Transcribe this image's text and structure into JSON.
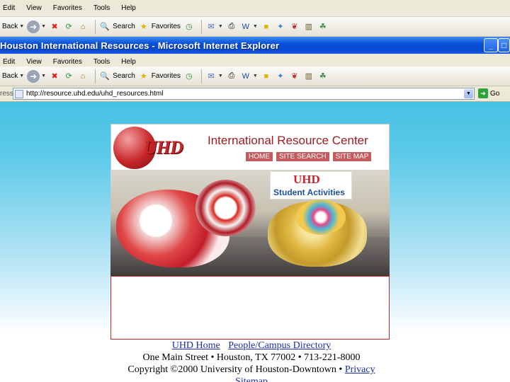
{
  "bg_menubar": {
    "items": [
      "Edit",
      "View",
      "Favorites",
      "Tools",
      "Help"
    ],
    "partial_first": "Edit"
  },
  "bg_toolbar": {
    "back_label": "Back",
    "search_label": "Search",
    "favorites_label": "Favorites"
  },
  "window": {
    "title": "Houston International Resources - Microsoft Internet Explorer",
    "minimize": "_",
    "maximize": "□"
  },
  "menubar": {
    "items": [
      "Edit",
      "View",
      "Favorites",
      "Tools",
      "Help"
    ]
  },
  "toolbar": {
    "back_label": "Back",
    "search_label": "Search",
    "favorites_label": "Favorites"
  },
  "address": {
    "label": "ress",
    "url": "http://resource.uhd.edu/uhd_resources.html",
    "go_label": "Go"
  },
  "site": {
    "logo_text": "UHD",
    "title": "International Resource Center",
    "nav": [
      "HOME",
      "SITE SEARCH",
      "SITE MAP"
    ],
    "banner_logo": "UHD",
    "banner_text": "Student Activities"
  },
  "footer": {
    "link_home": "UHD Home",
    "link_directory": "People/Campus Directory",
    "address_line": "One Main Street • Houston, TX 77002 • 713-221-8000",
    "copyright": "Copyright ©2000 University of Houston-Downtown • ",
    "link_privacy": "Privacy",
    "link_sitemap": "Sitemap"
  },
  "colors": {
    "title_bar": "#0a4fd8",
    "uhd_red": "#c8262a",
    "link_blue": "#1a2fa0",
    "page_bg_top": "#1fb3d8"
  }
}
